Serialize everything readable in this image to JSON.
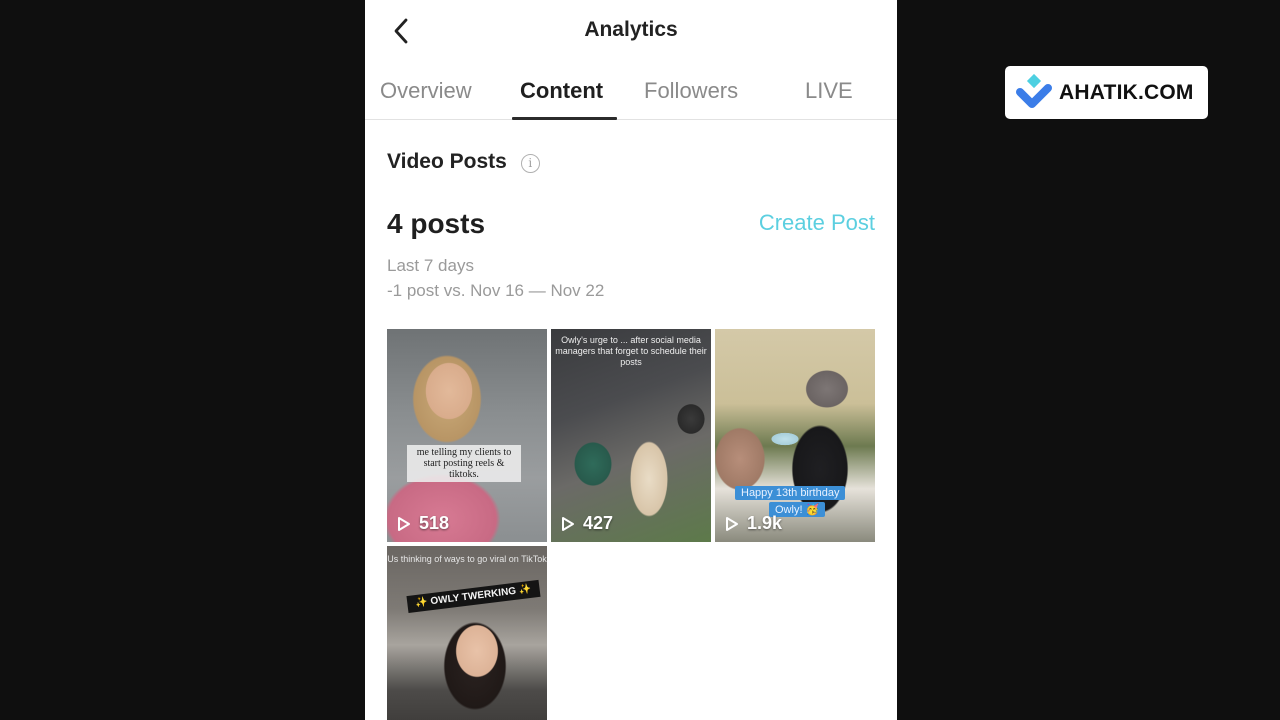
{
  "header": {
    "title": "Analytics",
    "back_icon": "chevron-left-icon"
  },
  "tabs": [
    {
      "label": "Overview",
      "active": false
    },
    {
      "label": "Content",
      "active": true
    },
    {
      "label": "Followers",
      "active": false
    },
    {
      "label": "LIVE",
      "active": false
    }
  ],
  "section": {
    "title": "Video Posts",
    "info_icon": "info-icon",
    "info_glyph": "i"
  },
  "summary": {
    "count": "4 posts",
    "create_label": "Create Post",
    "period": "Last 7 days",
    "comparison": "-1 post vs. Nov 16 — Nov 22"
  },
  "posts": [
    {
      "views": "518",
      "caption": "me telling my clients to start posting reels & tiktoks."
    },
    {
      "views": "427",
      "caption": "Owly's urge to ... after social media managers that forget to schedule their posts"
    },
    {
      "views": "1.9k",
      "caption_line1": "Happy 13th birthday",
      "caption_line2": "Owly! 🥳"
    },
    {
      "views": "",
      "caption": "Us thinking of ways to go viral on TikTok",
      "tag": "✨ OWLY TWERKING ✨"
    }
  ],
  "brand": {
    "name": "AHATIK.COM",
    "colors": {
      "light": "#4dd0e1",
      "dark": "#3b7de8"
    }
  },
  "colors": {
    "accent": "#5ccfe0",
    "text_primary": "#1f1f1f",
    "text_muted": "#9a9a9a",
    "backdrop": "#0f0f0f"
  }
}
